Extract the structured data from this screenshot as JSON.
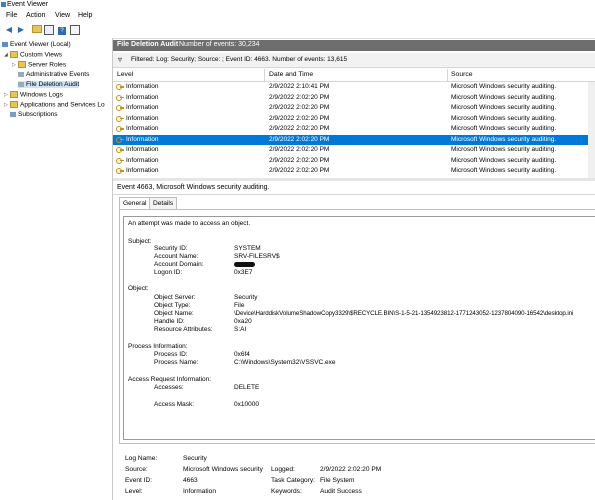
{
  "window": {
    "title": "Event Viewer"
  },
  "menu": [
    "File",
    "Action",
    "View",
    "Help"
  ],
  "toolbar": {
    "icons": [
      "back-icon",
      "forward-icon",
      "folder-up-icon",
      "show-hide-tree-icon",
      "help-icon",
      "properties-icon"
    ]
  },
  "tree": {
    "root": "Event Viewer (Local)",
    "custom_views": "Custom Views",
    "server_roles": "Server Roles",
    "admin_events": "Administrative Events",
    "file_deletion": "File Deletion Audit",
    "windows_logs": "Windows Logs",
    "apps_services": "Applications and Services Lo",
    "subscriptions": "Subscriptions"
  },
  "header": {
    "view_name": "File Deletion Audit",
    "count": "Number of events: 30,234"
  },
  "filter": {
    "text": "Filtered: Log: Security; Source: ; Event ID: 4663. Number of events: 13,615"
  },
  "columns": {
    "level": "Level",
    "date": "Date and Time",
    "source": "Source"
  },
  "rows": [
    {
      "level": "Information",
      "date": "2/9/2022 2:10:41 PM",
      "source": "Microsoft Windows security auditing."
    },
    {
      "level": "Information",
      "date": "2/9/2022 2:02:20 PM",
      "source": "Microsoft Windows security auditing."
    },
    {
      "level": "Information",
      "date": "2/9/2022 2:02:20 PM",
      "source": "Microsoft Windows security auditing."
    },
    {
      "level": "Information",
      "date": "2/9/2022 2:02:20 PM",
      "source": "Microsoft Windows security auditing."
    },
    {
      "level": "Information",
      "date": "2/9/2022 2:02:20 PM",
      "source": "Microsoft Windows security auditing."
    },
    {
      "level": "Information",
      "date": "2/9/2022 2:02:20 PM",
      "source": "Microsoft Windows security auditing."
    },
    {
      "level": "Information",
      "date": "2/9/2022 2:02:20 PM",
      "source": "Microsoft Windows security auditing."
    },
    {
      "level": "Information",
      "date": "2/9/2022 2:02:20 PM",
      "source": "Microsoft Windows security auditing."
    },
    {
      "level": "Information",
      "date": "2/9/2022 2:02:20 PM",
      "source": "Microsoft Windows security auditing."
    }
  ],
  "selected_row": 5,
  "event": {
    "title": "Event 4663, Microsoft Windows security auditing.",
    "tabs": [
      "General",
      "Details"
    ],
    "description": "An attempt was made to access an object.",
    "subject_header": "Subject:",
    "subject": [
      {
        "k": "Security ID:",
        "v": "SYSTEM"
      },
      {
        "k": "Account Name:",
        "v": "SRV-FILESRV$"
      },
      {
        "k": "Account Domain:",
        "v": ""
      },
      {
        "k": "Logon ID:",
        "v": "0x3E7"
      }
    ],
    "object_header": "Object:",
    "object": [
      {
        "k": "Object Server:",
        "v": "Security"
      },
      {
        "k": "Object Type:",
        "v": "File"
      },
      {
        "k": "Object Name:",
        "v": "\\Device\\HarddiskVolumeShadowCopy3329\\$RECYCLE.BIN\\S-1-5-21-1354923812-1771243052-1237804090-16542\\desktop.ini"
      },
      {
        "k": "Handle ID:",
        "v": "0xa20"
      },
      {
        "k": "Resource Attributes:",
        "v": "S:AI"
      }
    ],
    "process_header": "Process Information:",
    "process": [
      {
        "k": "Process ID:",
        "v": "0x6f4"
      },
      {
        "k": "Process Name:",
        "v": "C:\\Windows\\System32\\VSSVC.exe"
      }
    ],
    "access_header": "Access Request Information:",
    "access": [
      {
        "k": "Accesses:",
        "v": "DELETE"
      },
      {
        "k": "Access Mask:",
        "v": "0x10000"
      }
    ]
  },
  "meta": {
    "log_name_label": "Log Name:",
    "log_name": "Security",
    "source_label": "Source:",
    "source": "Microsoft Windows security",
    "logged_label": "Logged:",
    "logged": "2/9/2022 2:02:20 PM",
    "event_id_label": "Event ID:",
    "event_id": "4663",
    "task_label": "Task Category:",
    "task": "File System",
    "level_label": "Level:",
    "level": "Information",
    "keywords_label": "Keywords:",
    "keywords": "Audit Success"
  },
  "colors": {
    "selection": "#0078d7",
    "header_bar": "#6e6e6e",
    "key_icon": "#c89212"
  }
}
